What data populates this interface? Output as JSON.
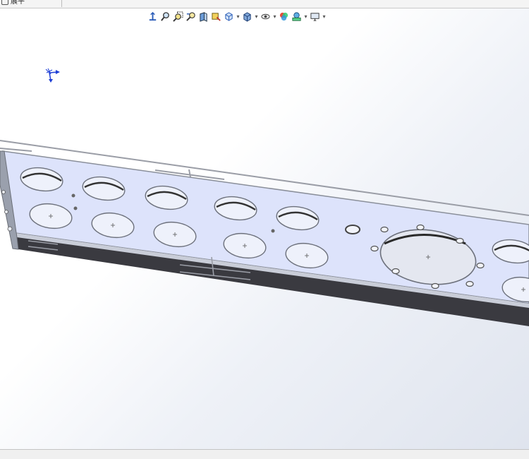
{
  "document_tab": {
    "label": "展平"
  },
  "toolbar": {
    "icons": [
      "normal-to-icon",
      "zoom-to-fit-icon",
      "zoom-area-icon",
      "previous-view-icon",
      "section-view-icon",
      "dynamic-annotation-icon",
      "view-orientation-icon",
      "display-style-icon",
      "hide-show-items-icon",
      "edit-appearance-icon",
      "apply-scene-icon",
      "view-settings-icon"
    ]
  },
  "colors": {
    "panel_face": "#dde3fb",
    "panel_edge": "#8a8f9a",
    "flange": "#3a3a40",
    "hole_fill": "#eef1fb",
    "triad_blue": "#1f3fd6"
  }
}
